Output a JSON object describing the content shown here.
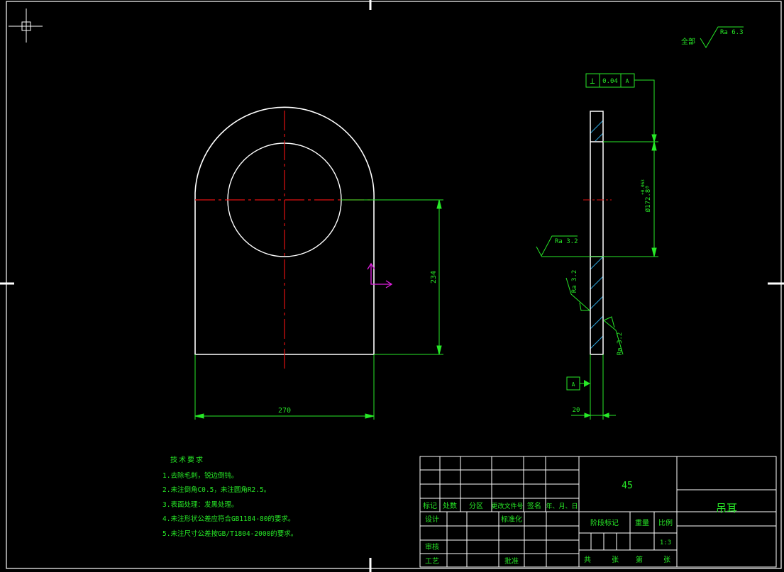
{
  "colors": {
    "background": "#000000",
    "outline": "#ffffff",
    "dimension": "#27e827",
    "centerline": "#e01010",
    "ucs": "#e020e0",
    "hatch": "#2aa0d8"
  },
  "roughness": {
    "global_prefix": "全部",
    "global_value": "Ra 6.3",
    "side_left": "Ra 3.2",
    "side_lower_left": "Ra 3.2",
    "side_lower_right": "Ra 3.2"
  },
  "tolerance_frame": {
    "symbol": "⊥",
    "value": "0.04",
    "datum": "A"
  },
  "datum_label": "A",
  "dimensions": {
    "width": "270",
    "height": "234",
    "thickness": "20",
    "bore": "Ø172.8",
    "bore_tol_upper": "+0.063",
    "bore_tol_lower": "0"
  },
  "tech_requirements": {
    "title": "技术要求",
    "items": [
      "1.去除毛刺，锐边倒钝。",
      "2.未注倒角C0.5，未注圆角R2.5。",
      "3.表面处理：发黑处理。",
      "4.未注形状公差应符合GB1184-80的要求。",
      "5.未注尺寸公差按GB/T1804-2000的要求。"
    ]
  },
  "title_block": {
    "material": "45",
    "part_name": "吊耳",
    "rev_headers": [
      "标记",
      "处数",
      "分区",
      "更改文件号",
      "签名",
      "年、月、日"
    ],
    "design": "设计",
    "standardize": "标准化",
    "review": "审核",
    "process": "工艺",
    "approve": "批准",
    "stage_mark": "阶段标记",
    "weight": "重量",
    "scale_label": "比例",
    "scale_value": "1:3",
    "sheet_total": "共",
    "sheet_unit": "张",
    "sheet_num": "第",
    "sheet_unit2": "张"
  }
}
